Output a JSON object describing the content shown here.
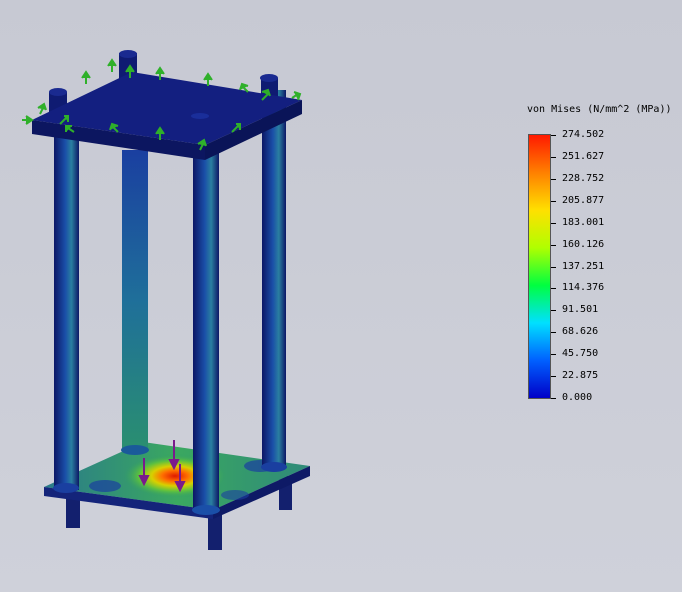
{
  "legend": {
    "title": "von Mises (N/mm^2 (MPa))",
    "gradient": [
      "#0000c8",
      "#0060ff",
      "#00e0ff",
      "#00ff40",
      "#b0ff00",
      "#ffe000",
      "#ff8000",
      "#ff1a00"
    ],
    "ticks": [
      "274.502",
      "251.627",
      "228.752",
      "205.877",
      "183.001",
      "160.126",
      "137.251",
      "114.376",
      "91.501",
      "68.626",
      "45.750",
      "22.875",
      "0.000"
    ]
  },
  "model": {
    "body_color": "#101e78",
    "low_stress_color": "#1a3fa0",
    "mid_stress_color": "#2fa36a",
    "high_stress_color": "#d04010",
    "fixture_color": "#2fb02a",
    "load_color": "#7a1a8c"
  }
}
